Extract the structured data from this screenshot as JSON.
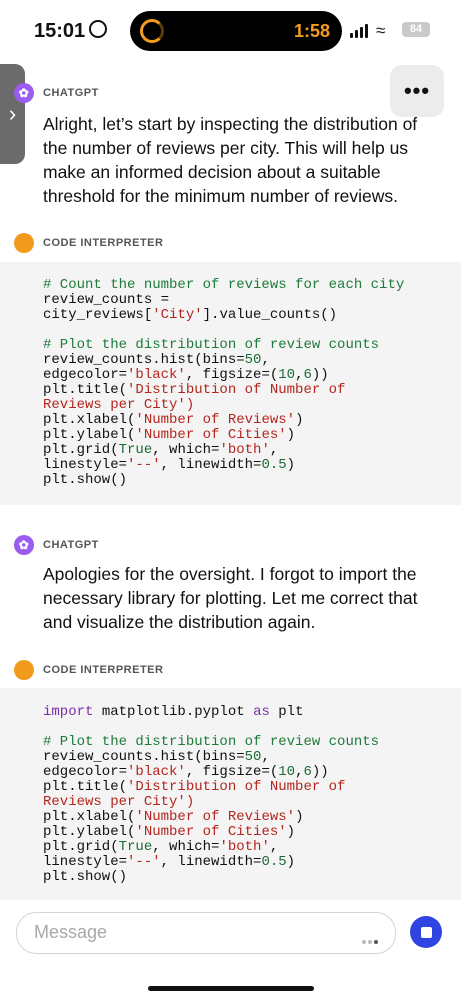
{
  "status_bar": {
    "time": "15:01",
    "timer": "1:58",
    "battery": "84",
    "accent_color": "#f29d1e"
  },
  "header": {
    "more_label": "•••",
    "side_handle_label": "›"
  },
  "messages": [
    {
      "role": "CHATGPT",
      "text": "Alright, let’s start by inspecting the distribution of the number of reviews per city. This will help us make an informed decision about a suitable threshold for the minimum number of reviews."
    },
    {
      "role": "CODE INTERPRETER",
      "code": [
        "# Count the number of reviews for each city",
        "review_counts =",
        "city_reviews['City'].value_counts()",
        "",
        "# Plot the distribution of review counts",
        "review_counts.hist(bins=50,",
        "edgecolor='black', figsize=(10,6))",
        "plt.title('Distribution of Number of",
        "Reviews per City')",
        "plt.xlabel('Number of Reviews')",
        "plt.ylabel('Number of Cities')",
        "plt.grid(True, which='both',",
        "linestyle='--', linewidth=0.5)",
        "plt.show()"
      ]
    },
    {
      "role": "CHATGPT",
      "text": "Apologies for the oversight. I forgot to import the necessary library for plotting. Let me correct that and visualize the distribution again."
    },
    {
      "role": "CODE INTERPRETER",
      "code": [
        "import matplotlib.pyplot as plt",
        "",
        "# Plot the distribution of review counts",
        "review_counts.hist(bins=50,",
        "edgecolor='black', figsize=(10,6))",
        "plt.title('Distribution of Number of",
        "Reviews per City')",
        "plt.xlabel('Number of Reviews')",
        "plt.ylabel('Number of Cities')",
        "plt.grid(True, which='both',",
        "linestyle='--', linewidth=0.5)",
        "plt.show()"
      ]
    }
  ],
  "composer": {
    "placeholder": "Message",
    "send_color": "#2f44e0"
  },
  "icons": {
    "chatgpt_avatar": "openai-logo-icon",
    "code_interpreter_avatar": "orange-dot-icon",
    "send": "stop-square-icon"
  }
}
